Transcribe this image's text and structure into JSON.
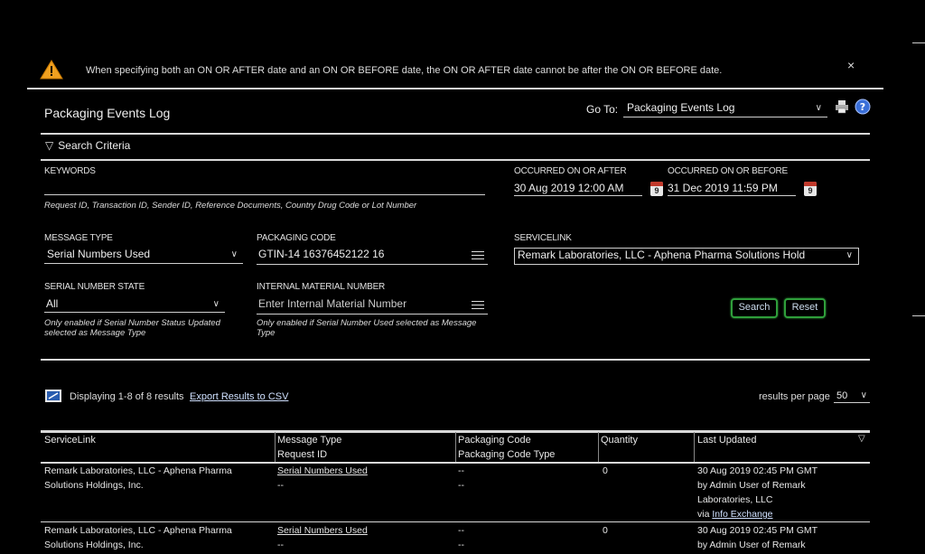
{
  "alert": {
    "message": "When specifying both an ON OR AFTER date and an ON OR BEFORE date, the ON OR AFTER date cannot be after the ON OR BEFORE date.",
    "close": "×"
  },
  "header": {
    "title": "Packaging Events Log",
    "goto_label": "Go To:",
    "goto_value": "Packaging Events Log"
  },
  "search": {
    "toggle_label": "Search Criteria",
    "keywords": {
      "label": "KEYWORDS",
      "value": "",
      "hint": "Request ID, Transaction ID, Sender ID, Reference Documents, Country Drug Code or Lot Number"
    },
    "occurred_after": {
      "label": "OCCURRED ON OR AFTER",
      "value": "30 Aug 2019 12:00 AM",
      "cal_day": "9"
    },
    "occurred_before": {
      "label": "OCCURRED ON OR BEFORE",
      "value": "31 Dec 2019 11:59 PM",
      "cal_day": "9"
    },
    "message_type": {
      "label": "MESSAGE TYPE",
      "value": "Serial Numbers Used"
    },
    "packaging_code": {
      "label": "PACKAGING CODE",
      "value": "GTIN-14 16376452122 16"
    },
    "servicelink": {
      "label": "SERVICELINK",
      "value": "Remark Laboratories, LLC - Aphena Pharma Solutions Hold"
    },
    "serial_state": {
      "label": "SERIAL NUMBER STATE",
      "value": "All",
      "hint": "Only enabled if Serial Number Status Updated selected as Message Type"
    },
    "internal_material": {
      "label": "INTERNAL MATERIAL NUMBER",
      "placeholder": "Enter Internal Material Number",
      "hint": "Only enabled if Serial Number Used selected as Message Type"
    },
    "search_button": "Search",
    "reset_button": "Reset"
  },
  "results": {
    "summary": "Displaying 1-8 of 8 results",
    "export_link": "Export Results to CSV",
    "per_page_label": "results per page",
    "per_page_value": "50"
  },
  "table": {
    "columns": {
      "servicelink": "ServiceLink",
      "message_type": "Message Type",
      "request_id": "Request ID",
      "packaging_code": "Packaging Code",
      "packaging_code_type": "Packaging Code Type",
      "quantity": "Quantity",
      "last_updated": "Last Updated"
    },
    "rows": [
      {
        "servicelink_1": "Remark Laboratories, LLC - Aphena Pharma",
        "servicelink_2": "Solutions Holdings, Inc.",
        "message_type": "Serial Numbers Used",
        "request_id": "--",
        "packaging_code": "--",
        "packaging_code_type": "--",
        "quantity": "0",
        "updated_1": "30 Aug 2019 02:45 PM GMT",
        "updated_2": "by Admin User of Remark",
        "updated_3": "Laboratories, LLC",
        "updated_via": "via",
        "updated_link": "Info Exchange"
      },
      {
        "servicelink_1": "Remark Laboratories, LLC - Aphena Pharma",
        "servicelink_2": "Solutions Holdings, Inc.",
        "message_type": "Serial Numbers Used",
        "request_id": "--",
        "packaging_code": "--",
        "packaging_code_type": "--",
        "quantity": "0",
        "updated_1": "30 Aug 2019 02:45 PM GMT",
        "updated_2": "by Admin User of Remark"
      }
    ]
  }
}
